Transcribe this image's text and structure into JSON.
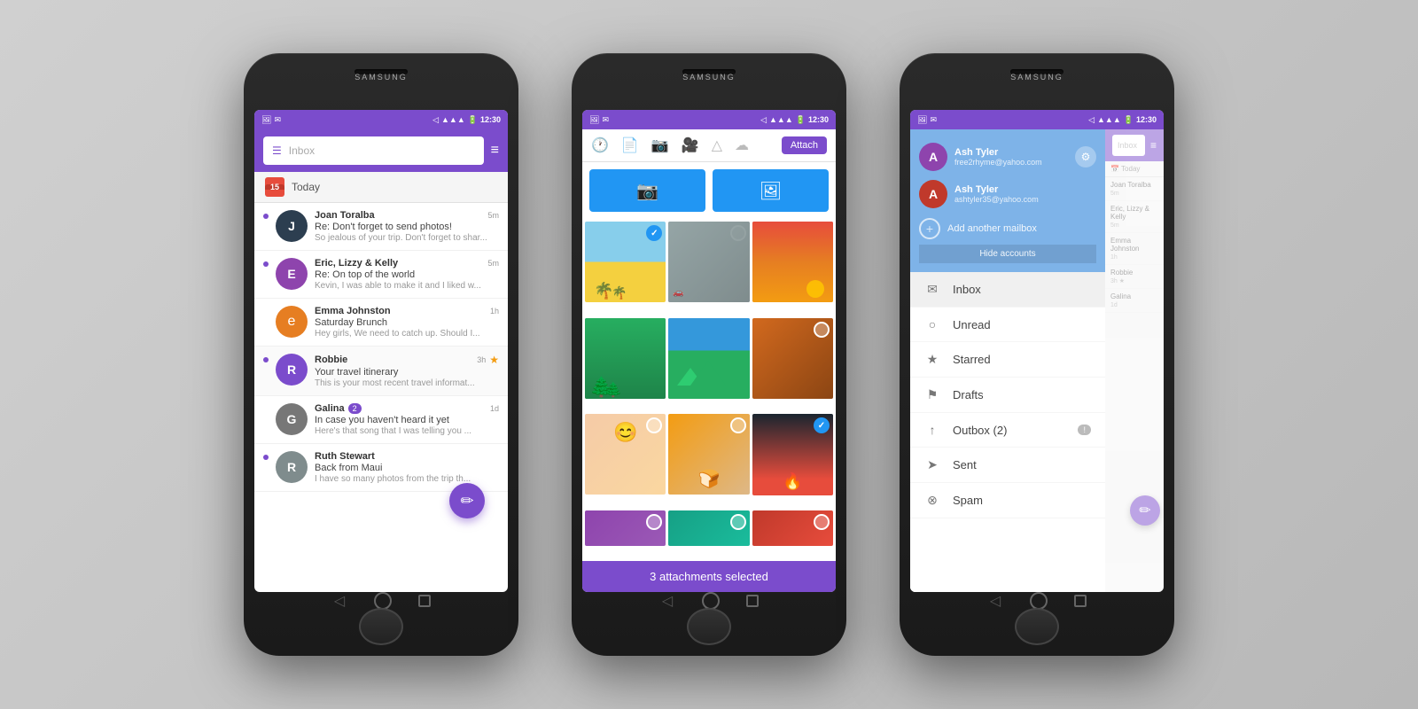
{
  "phones": [
    {
      "id": "phone1",
      "brand": "SAMSUNG",
      "statusBar": {
        "time": "12:30",
        "icons": "◁ ▽ ○"
      },
      "header": {
        "searchPlaceholder": "Inbox",
        "menuIcon": "☰",
        "listIcon": "≡"
      },
      "dateSection": {
        "number": "15",
        "label": "Today"
      },
      "emails": [
        {
          "sender": "Joan Toralba",
          "subject": "Re: Don't forget to send photos!",
          "preview": "So jealous of your trip. Don't forget to shar...",
          "time": "5m",
          "unread": true,
          "avatarLabel": "J",
          "avatarClass": "avatar-joan"
        },
        {
          "sender": "Eric, Lizzy & Kelly",
          "subject": "Re: On top of the world",
          "preview": "Kevin, I was able to make it and I liked w...",
          "time": "5m",
          "unread": true,
          "avatarLabel": "E",
          "avatarClass": "avatar-eric"
        },
        {
          "sender": "Emma Johnston",
          "subject": "Saturday Brunch",
          "preview": "Hey girls, We need to catch up. Should I...",
          "time": "1h",
          "unread": false,
          "avatarLabel": "e",
          "avatarClass": "avatar-emma"
        },
        {
          "sender": "Robbie",
          "subject": "Your travel itinerary",
          "preview": "This is your most recent travel informat...",
          "time": "3h",
          "unread": true,
          "starred": true,
          "avatarLabel": "R",
          "avatarClass": "avatar-robbie"
        },
        {
          "sender": "Galina",
          "subject": "In case you haven't heard it yet",
          "preview": "Here's that song that I was telling you ...",
          "time": "1d",
          "unread": false,
          "badge": "2",
          "avatarLabel": "G",
          "avatarClass": "avatar-galina"
        },
        {
          "sender": "Ruth Stewart",
          "subject": "Back from Maui",
          "preview": "I have so many photos from the trip th...",
          "time": "",
          "unread": true,
          "avatarLabel": "R",
          "avatarClass": "avatar-ruth"
        }
      ],
      "fab": "✏"
    },
    {
      "id": "phone2",
      "brand": "SAMSUNG",
      "statusBar": {
        "time": "12:30"
      },
      "attachHeader": {
        "attachLabel": "Attach",
        "icons": [
          "🕐",
          "📄",
          "📷",
          "🎥",
          "△",
          "☁"
        ]
      },
      "photoBtns": [
        "📷",
        "🖼"
      ],
      "photos": [
        {
          "id": 1,
          "checked": true,
          "scene": "scene-beach"
        },
        {
          "id": 2,
          "checked": false,
          "scene": "scene-road"
        },
        {
          "id": 3,
          "checked": false,
          "scene": "scene-sunset"
        },
        {
          "id": 4,
          "checked": false,
          "scene": "scene-forest"
        },
        {
          "id": 5,
          "checked": true,
          "scene": "scene-mountains"
        },
        {
          "id": 6,
          "checked": false,
          "scene": "scene-partial1"
        },
        {
          "id": 7,
          "checked": false,
          "scene": "scene-girl"
        },
        {
          "id": 8,
          "checked": false,
          "scene": "scene-food"
        },
        {
          "id": 9,
          "checked": true,
          "scene": "scene-campfire"
        },
        {
          "id": 10,
          "checked": false,
          "scene": "scene-partial2"
        },
        {
          "id": 11,
          "checked": false,
          "scene": "scene-partial3"
        },
        {
          "id": 12,
          "checked": false,
          "scene": "scene-partial1"
        }
      ],
      "footer": "3 attachments selected"
    },
    {
      "id": "phone3",
      "brand": "SAMSUNG",
      "statusBar": {
        "time": "12:30"
      },
      "accounts": [
        {
          "name": "Ash Tyler",
          "email": "free2rhyme@yahoo.com",
          "avatarColor": "#8e44ad"
        },
        {
          "name": "Ash Tyler",
          "email": "ashtyler35@yahoo.com",
          "avatarColor": "#c0392b"
        }
      ],
      "addMailbox": "Add another mailbox",
      "hideAccounts": "Hide accounts",
      "navItems": [
        {
          "label": "Inbox",
          "icon": "✉",
          "active": true
        },
        {
          "label": "Unread",
          "icon": "○"
        },
        {
          "label": "Starred",
          "icon": "★"
        },
        {
          "label": "Drafts",
          "icon": "⚑"
        },
        {
          "label": "Outbox (2)",
          "icon": "↑",
          "badge": "!"
        },
        {
          "label": "Sent",
          "icon": "➤"
        },
        {
          "label": "Spam",
          "icon": "⊗"
        }
      ]
    }
  ]
}
